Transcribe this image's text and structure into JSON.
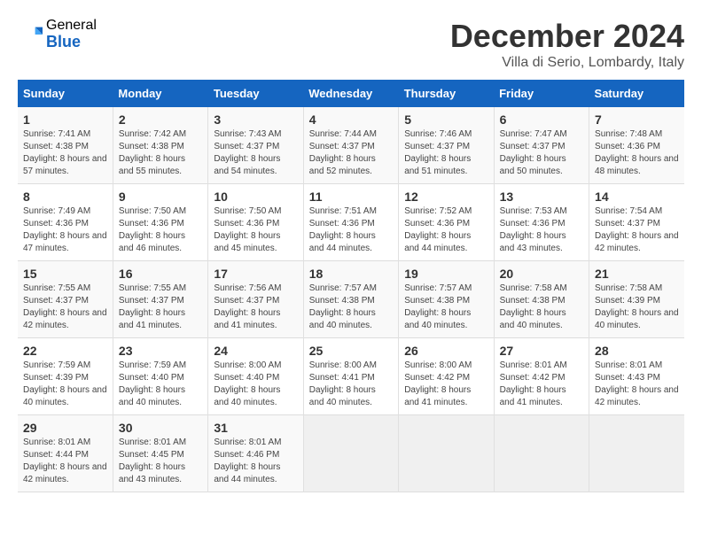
{
  "header": {
    "logo_general": "General",
    "logo_blue": "Blue",
    "month_title": "December 2024",
    "location": "Villa di Serio, Lombardy, Italy"
  },
  "weekdays": [
    "Sunday",
    "Monday",
    "Tuesday",
    "Wednesday",
    "Thursday",
    "Friday",
    "Saturday"
  ],
  "weeks": [
    [
      {
        "day": "1",
        "sunrise": "Sunrise: 7:41 AM",
        "sunset": "Sunset: 4:38 PM",
        "daylight": "Daylight: 8 hours and 57 minutes."
      },
      {
        "day": "2",
        "sunrise": "Sunrise: 7:42 AM",
        "sunset": "Sunset: 4:38 PM",
        "daylight": "Daylight: 8 hours and 55 minutes."
      },
      {
        "day": "3",
        "sunrise": "Sunrise: 7:43 AM",
        "sunset": "Sunset: 4:37 PM",
        "daylight": "Daylight: 8 hours and 54 minutes."
      },
      {
        "day": "4",
        "sunrise": "Sunrise: 7:44 AM",
        "sunset": "Sunset: 4:37 PM",
        "daylight": "Daylight: 8 hours and 52 minutes."
      },
      {
        "day": "5",
        "sunrise": "Sunrise: 7:46 AM",
        "sunset": "Sunset: 4:37 PM",
        "daylight": "Daylight: 8 hours and 51 minutes."
      },
      {
        "day": "6",
        "sunrise": "Sunrise: 7:47 AM",
        "sunset": "Sunset: 4:37 PM",
        "daylight": "Daylight: 8 hours and 50 minutes."
      },
      {
        "day": "7",
        "sunrise": "Sunrise: 7:48 AM",
        "sunset": "Sunset: 4:36 PM",
        "daylight": "Daylight: 8 hours and 48 minutes."
      }
    ],
    [
      {
        "day": "8",
        "sunrise": "Sunrise: 7:49 AM",
        "sunset": "Sunset: 4:36 PM",
        "daylight": "Daylight: 8 hours and 47 minutes."
      },
      {
        "day": "9",
        "sunrise": "Sunrise: 7:50 AM",
        "sunset": "Sunset: 4:36 PM",
        "daylight": "Daylight: 8 hours and 46 minutes."
      },
      {
        "day": "10",
        "sunrise": "Sunrise: 7:50 AM",
        "sunset": "Sunset: 4:36 PM",
        "daylight": "Daylight: 8 hours and 45 minutes."
      },
      {
        "day": "11",
        "sunrise": "Sunrise: 7:51 AM",
        "sunset": "Sunset: 4:36 PM",
        "daylight": "Daylight: 8 hours and 44 minutes."
      },
      {
        "day": "12",
        "sunrise": "Sunrise: 7:52 AM",
        "sunset": "Sunset: 4:36 PM",
        "daylight": "Daylight: 8 hours and 44 minutes."
      },
      {
        "day": "13",
        "sunrise": "Sunrise: 7:53 AM",
        "sunset": "Sunset: 4:36 PM",
        "daylight": "Daylight: 8 hours and 43 minutes."
      },
      {
        "day": "14",
        "sunrise": "Sunrise: 7:54 AM",
        "sunset": "Sunset: 4:37 PM",
        "daylight": "Daylight: 8 hours and 42 minutes."
      }
    ],
    [
      {
        "day": "15",
        "sunrise": "Sunrise: 7:55 AM",
        "sunset": "Sunset: 4:37 PM",
        "daylight": "Daylight: 8 hours and 42 minutes."
      },
      {
        "day": "16",
        "sunrise": "Sunrise: 7:55 AM",
        "sunset": "Sunset: 4:37 PM",
        "daylight": "Daylight: 8 hours and 41 minutes."
      },
      {
        "day": "17",
        "sunrise": "Sunrise: 7:56 AM",
        "sunset": "Sunset: 4:37 PM",
        "daylight": "Daylight: 8 hours and 41 minutes."
      },
      {
        "day": "18",
        "sunrise": "Sunrise: 7:57 AM",
        "sunset": "Sunset: 4:38 PM",
        "daylight": "Daylight: 8 hours and 40 minutes."
      },
      {
        "day": "19",
        "sunrise": "Sunrise: 7:57 AM",
        "sunset": "Sunset: 4:38 PM",
        "daylight": "Daylight: 8 hours and 40 minutes."
      },
      {
        "day": "20",
        "sunrise": "Sunrise: 7:58 AM",
        "sunset": "Sunset: 4:38 PM",
        "daylight": "Daylight: 8 hours and 40 minutes."
      },
      {
        "day": "21",
        "sunrise": "Sunrise: 7:58 AM",
        "sunset": "Sunset: 4:39 PM",
        "daylight": "Daylight: 8 hours and 40 minutes."
      }
    ],
    [
      {
        "day": "22",
        "sunrise": "Sunrise: 7:59 AM",
        "sunset": "Sunset: 4:39 PM",
        "daylight": "Daylight: 8 hours and 40 minutes."
      },
      {
        "day": "23",
        "sunrise": "Sunrise: 7:59 AM",
        "sunset": "Sunset: 4:40 PM",
        "daylight": "Daylight: 8 hours and 40 minutes."
      },
      {
        "day": "24",
        "sunrise": "Sunrise: 8:00 AM",
        "sunset": "Sunset: 4:40 PM",
        "daylight": "Daylight: 8 hours and 40 minutes."
      },
      {
        "day": "25",
        "sunrise": "Sunrise: 8:00 AM",
        "sunset": "Sunset: 4:41 PM",
        "daylight": "Daylight: 8 hours and 40 minutes."
      },
      {
        "day": "26",
        "sunrise": "Sunrise: 8:00 AM",
        "sunset": "Sunset: 4:42 PM",
        "daylight": "Daylight: 8 hours and 41 minutes."
      },
      {
        "day": "27",
        "sunrise": "Sunrise: 8:01 AM",
        "sunset": "Sunset: 4:42 PM",
        "daylight": "Daylight: 8 hours and 41 minutes."
      },
      {
        "day": "28",
        "sunrise": "Sunrise: 8:01 AM",
        "sunset": "Sunset: 4:43 PM",
        "daylight": "Daylight: 8 hours and 42 minutes."
      }
    ],
    [
      {
        "day": "29",
        "sunrise": "Sunrise: 8:01 AM",
        "sunset": "Sunset: 4:44 PM",
        "daylight": "Daylight: 8 hours and 42 minutes."
      },
      {
        "day": "30",
        "sunrise": "Sunrise: 8:01 AM",
        "sunset": "Sunset: 4:45 PM",
        "daylight": "Daylight: 8 hours and 43 minutes."
      },
      {
        "day": "31",
        "sunrise": "Sunrise: 8:01 AM",
        "sunset": "Sunset: 4:46 PM",
        "daylight": "Daylight: 8 hours and 44 minutes."
      },
      null,
      null,
      null,
      null
    ]
  ]
}
